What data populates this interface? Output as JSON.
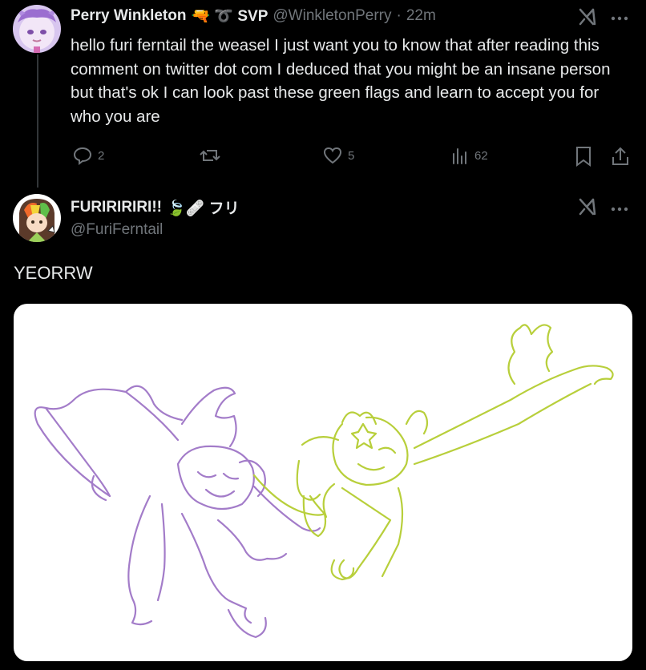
{
  "reply": {
    "author_name": "Perry Winkleton",
    "author_badges": "🔫 ➰ SVP",
    "author_handle": "@WinkletonPerry",
    "separator": "·",
    "time": "22m",
    "text": "hello furi ferntail the weasel I just want you to know that after reading this comment on twitter dot com I deduced that you might be an insane person but that's ok I can look past these green flags and learn to accept you for who you are",
    "actions": {
      "replies": "2",
      "reposts": "",
      "likes": "5",
      "views": "62"
    }
  },
  "main_post": {
    "author_name": "FURIRIRIRI!!",
    "author_badges": "🍃🩹 フリ",
    "author_handle": "@FuriFerntail",
    "text": "YEORRW"
  },
  "colors": {
    "background": "#000000",
    "text_primary": "#e7e9ea",
    "text_secondary": "#71767b",
    "sketch_purple": "#a37cc9",
    "sketch_green": "#b8cf3b"
  },
  "icons": [
    "reply-icon",
    "repost-icon",
    "like-icon",
    "views-icon",
    "bookmark-icon",
    "share-icon",
    "grok-icon",
    "more-icon"
  ]
}
